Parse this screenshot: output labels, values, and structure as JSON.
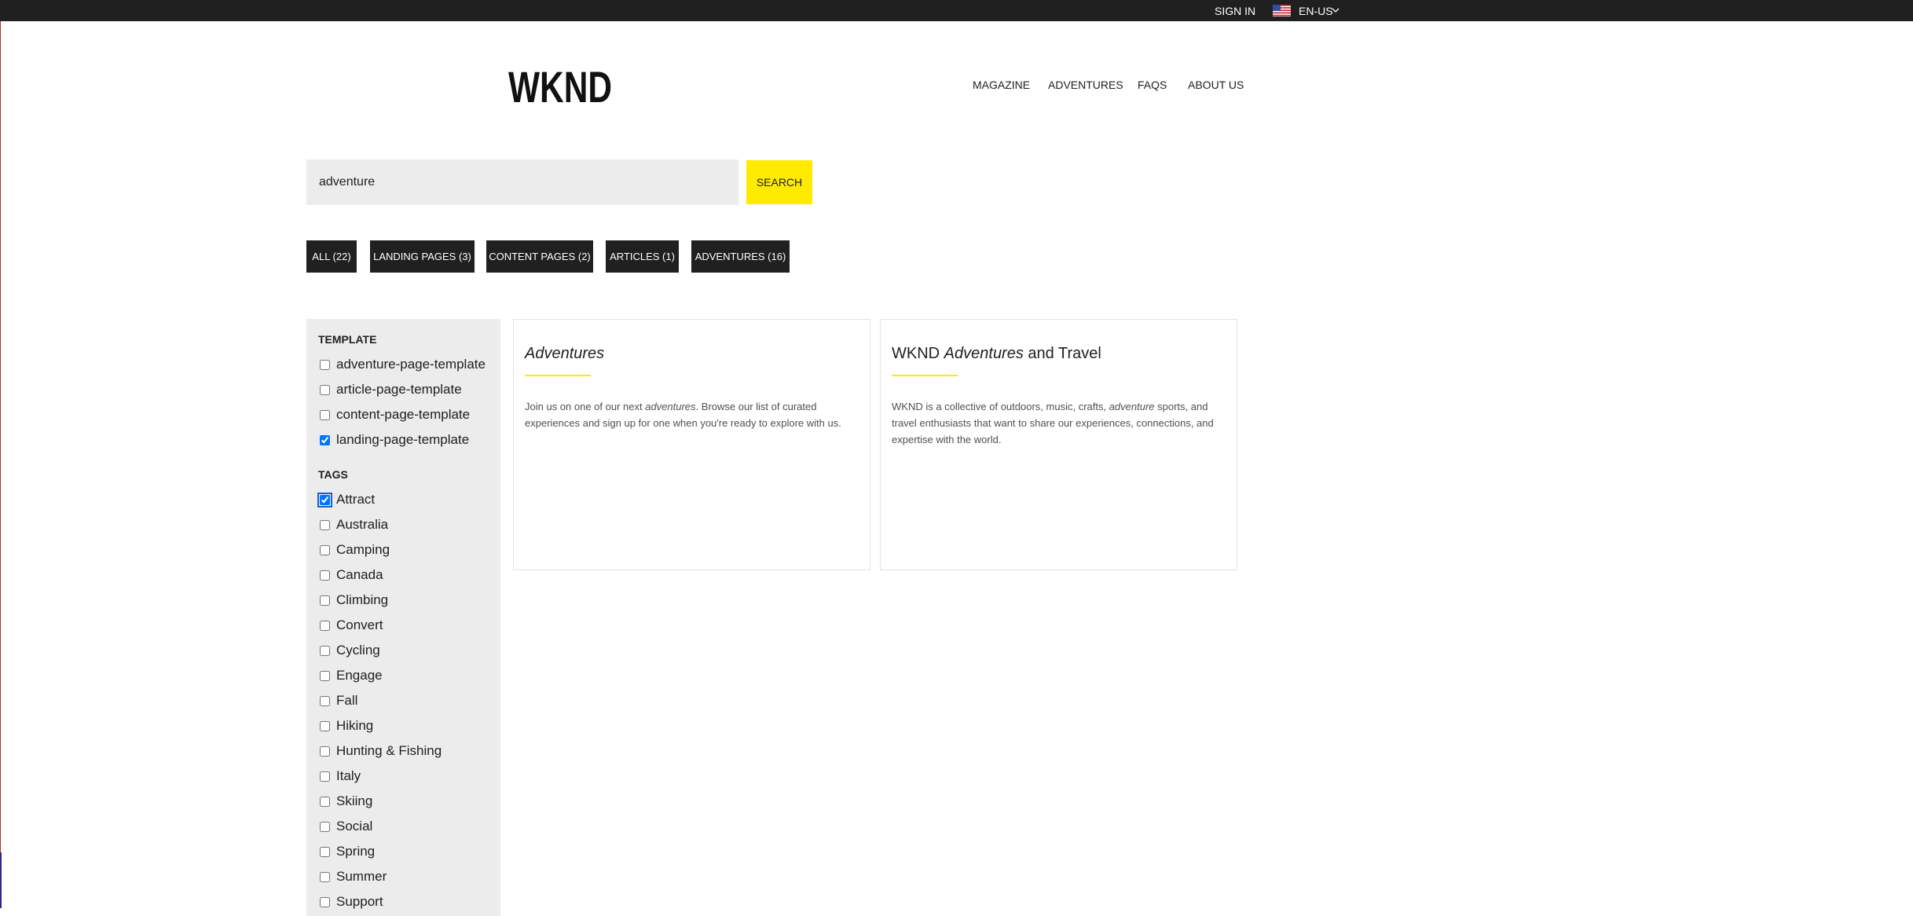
{
  "topbar": {
    "sign_in": "SIGN IN",
    "language": "EN-US",
    "flag_icon": "us-flag-icon",
    "chevron_icon": "chevron-down-icon"
  },
  "header": {
    "logo": "WKND",
    "nav": [
      "MAGAZINE",
      "ADVENTURES",
      "FAQS",
      "ABOUT US"
    ]
  },
  "search": {
    "value": "adventure",
    "button_label": "SEARCH"
  },
  "result_tabs": [
    "ALL (22)",
    "LANDING PAGES (3)",
    "CONTENT PAGES (2)",
    "ARTICLES (1)",
    "ADVENTURES (16)"
  ],
  "facets": {
    "template": {
      "heading": "TEMPLATE",
      "options": [
        {
          "label": "adventure-page-template",
          "checked": false
        },
        {
          "label": "article-page-template",
          "checked": false
        },
        {
          "label": "content-page-template",
          "checked": false
        },
        {
          "label": "landing-page-template",
          "checked": true
        }
      ]
    },
    "tags": {
      "heading": "TAGS",
      "options": [
        {
          "label": "Attract",
          "checked": true
        },
        {
          "label": "Australia",
          "checked": false
        },
        {
          "label": "Camping",
          "checked": false
        },
        {
          "label": "Canada",
          "checked": false
        },
        {
          "label": "Climbing",
          "checked": false
        },
        {
          "label": "Convert",
          "checked": false
        },
        {
          "label": "Cycling",
          "checked": false
        },
        {
          "label": "Engage",
          "checked": false
        },
        {
          "label": "Fall",
          "checked": false
        },
        {
          "label": "Hiking",
          "checked": false
        },
        {
          "label": "Hunting & Fishing",
          "checked": false
        },
        {
          "label": "Italy",
          "checked": false
        },
        {
          "label": "Skiing",
          "checked": false
        },
        {
          "label": "Social",
          "checked": false
        },
        {
          "label": "Spring",
          "checked": false
        },
        {
          "label": "Summer",
          "checked": false
        },
        {
          "label": "Support",
          "checked": false
        }
      ]
    }
  },
  "results": [
    {
      "title_before": "",
      "title_highlight": "Adventures",
      "title_after": "",
      "desc_before": "Join us on one of our next ",
      "desc_highlight": "adventures",
      "desc_after": ". Browse our list of curated experiences and sign up for one when you're ready to explore with us."
    },
    {
      "title_before": "WKND ",
      "title_highlight": "Adventures",
      "title_after": " and Travel",
      "desc_before": "WKND is a collective of outdoors, music, crafts, ",
      "desc_highlight": "adventure",
      "desc_after": " sports, and travel enthusiasts that want to share our experiences, connections, and expertise with the world."
    }
  ],
  "colors": {
    "topbar": "#202020",
    "accent_yellow": "#ffea00",
    "facet_panel": "#ececec",
    "search_field": "#ececec"
  }
}
